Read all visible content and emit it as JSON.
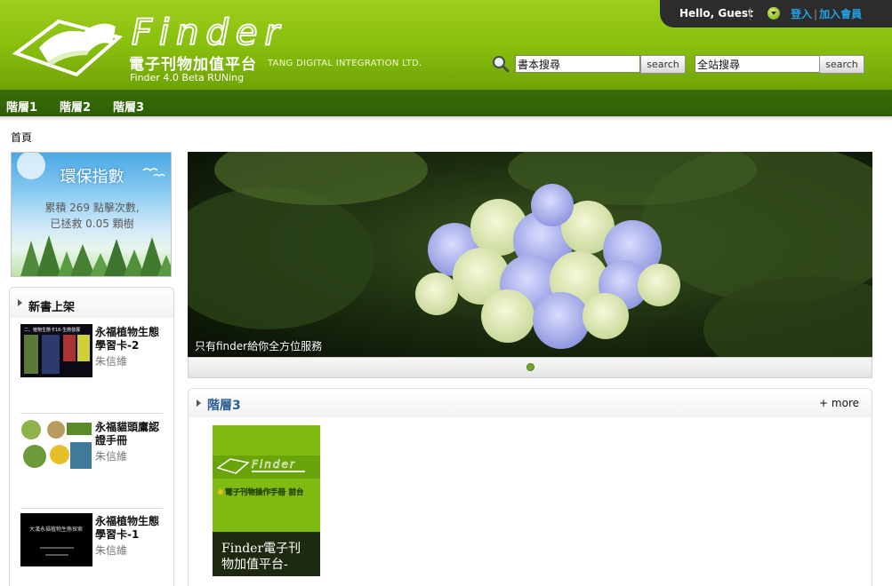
{
  "header": {
    "logo_word": "Finder",
    "brand_cn": "電子刊物加值平台",
    "brand_en": "TANG DIGITAL INTEGRATION LTD.",
    "version": "Finder 4.0 Beta RUNing"
  },
  "user": {
    "greeting": "Hello, Guest",
    "login_label": "登入",
    "separator": "|",
    "register_label": "加入會員"
  },
  "search": {
    "book_value": "書本搜尋",
    "site_value": "全站搜尋",
    "button_label": "search"
  },
  "nav": {
    "items": [
      {
        "label": "階層1"
      },
      {
        "label": "階層2"
      },
      {
        "label": "階層3"
      }
    ]
  },
  "breadcrumb": {
    "home": "首頁"
  },
  "eco": {
    "title": "環保指數",
    "line1": "累積 269 點擊次數,",
    "line2": "已拯救 0.05 顆樹"
  },
  "new_books": {
    "title": "新書上架",
    "items": [
      {
        "title": "永福植物生態學習卡-2",
        "author": "朱信維",
        "thumb_text": "二、植物生態卡16-生態發展"
      },
      {
        "title": "永福貓頭鷹認證手冊",
        "author": "朱信維",
        "thumb_text": ""
      },
      {
        "title": "永福植物生態學習卡-1",
        "author": "朱信維",
        "thumb_text": "大漢永福植物生態探索"
      }
    ]
  },
  "banner": {
    "caption": "只有finder給你全方位服務"
  },
  "section": {
    "title": "階層3",
    "more_label": "+ more",
    "ebook": {
      "cover_word": "Finder",
      "cover_title": "電子刊物操作手冊-前台",
      "caption": "Finder電子刊物加值平台-"
    }
  },
  "colors": {
    "header_green": "#86bd0d",
    "nav_green": "#2f5e05",
    "link_blue": "#1fa3e6",
    "section_title": "#2a5e94",
    "user_bar": "#2c2c2c"
  }
}
